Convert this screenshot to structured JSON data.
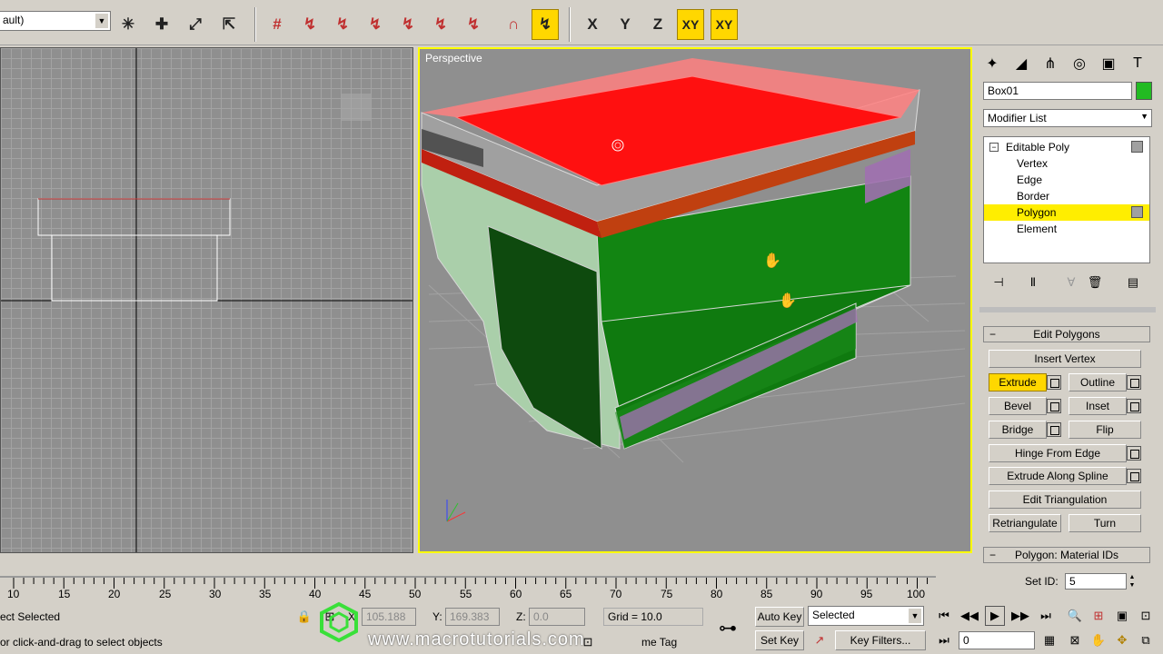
{
  "toolbar": {
    "selection_filter": "ault)",
    "axis_buttons": [
      "X",
      "Y",
      "Z",
      "XY",
      "XY"
    ]
  },
  "viewports": {
    "perspective_label": "Perspective"
  },
  "command_panel": {
    "object_name": "Box01",
    "object_color": "#22bb22",
    "modifier_list": "Modifier List",
    "stack": {
      "root": "Editable Poly",
      "items": [
        "Vertex",
        "Edge",
        "Border",
        "Polygon",
        "Element"
      ],
      "selected": "Polygon"
    },
    "edit_polygons": {
      "title": "Edit Polygons",
      "insert_vertex": "Insert Vertex",
      "extrude": "Extrude",
      "outline": "Outline",
      "bevel": "Bevel",
      "inset": "Inset",
      "bridge": "Bridge",
      "flip": "Flip",
      "hinge_from_edge": "Hinge From Edge",
      "extrude_along_spline": "Extrude Along Spline",
      "edit_triangulation": "Edit Triangulation",
      "retriangulate": "Retriangulate",
      "turn": "Turn"
    },
    "material_ids": {
      "title": "Polygon: Material IDs",
      "set_id_label": "Set ID:",
      "set_id_value": "5"
    }
  },
  "timeline": {
    "ticks": [
      "10",
      "15",
      "20",
      "25",
      "30",
      "35",
      "40",
      "45",
      "50",
      "55",
      "60",
      "65",
      "70",
      "75",
      "80",
      "85",
      "90",
      "95",
      "100"
    ]
  },
  "status": {
    "selection_text": "ect Selected",
    "prompt_text": "or click-and-drag to select objects",
    "x_label": "X:",
    "x_value": "105.188",
    "y_label": "Y:",
    "y_value": "169.383",
    "z_label": "Z:",
    "z_value": "0.0",
    "grid": "Grid = 10.0",
    "add_time_tag": "me Tag",
    "auto_key": "Auto Key",
    "set_key": "Set Key",
    "key_mode": "Selected",
    "key_filters": "Key Filters...",
    "frame_value": "0"
  },
  "watermark": "www.macrotutorials.com"
}
